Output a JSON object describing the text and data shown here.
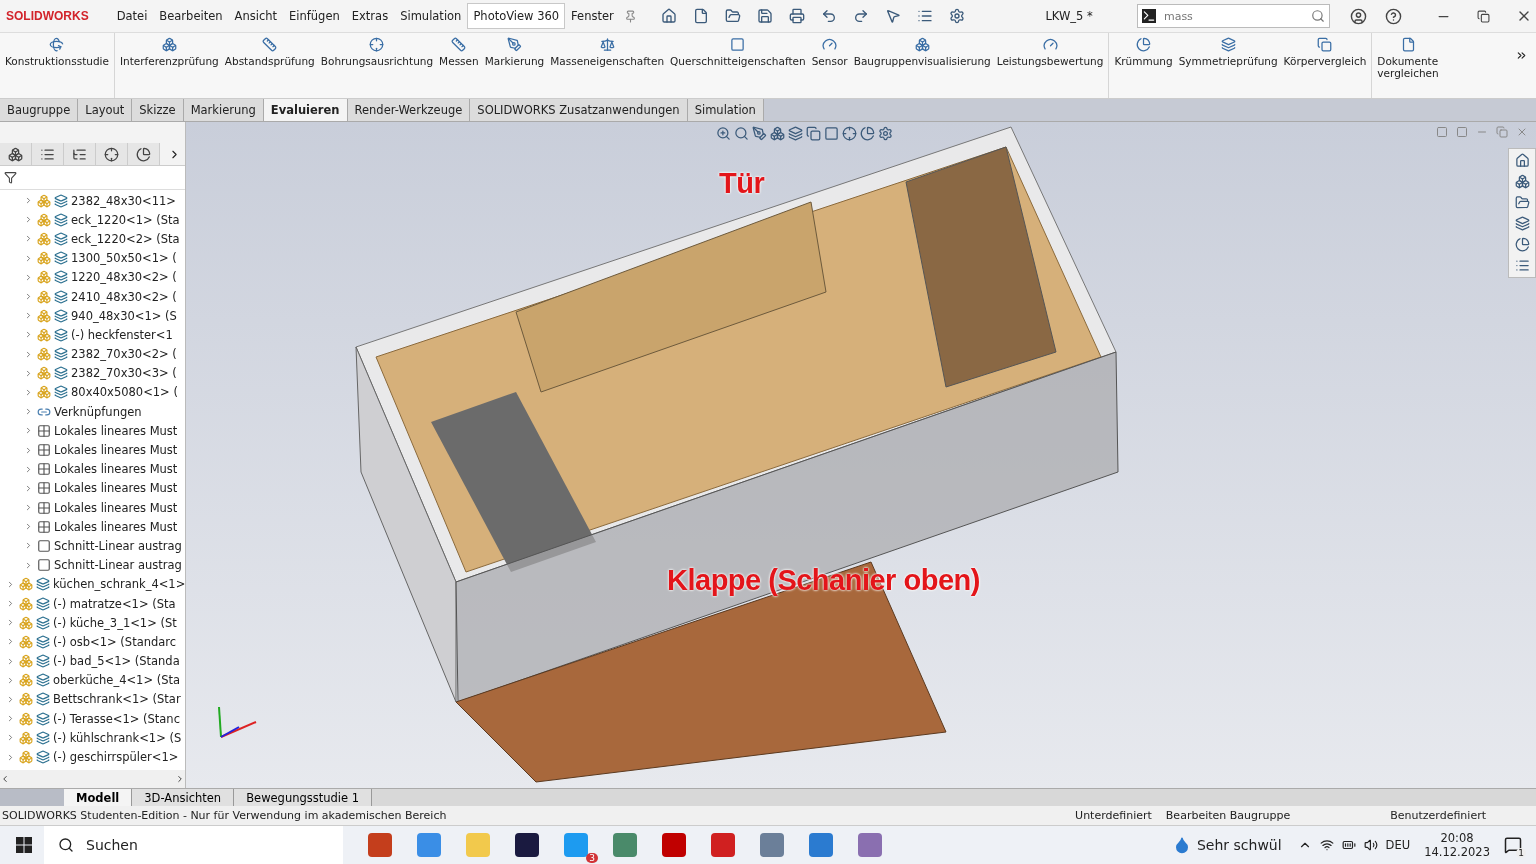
{
  "app": {
    "logo": "SOLIDWORKS",
    "document_title": "LKW_5 *"
  },
  "menu": [
    {
      "label": "Datei",
      "highlighted": false
    },
    {
      "label": "Bearbeiten",
      "highlighted": false
    },
    {
      "label": "Ansicht",
      "highlighted": false
    },
    {
      "label": "Einfügen",
      "highlighted": false
    },
    {
      "label": "Extras",
      "highlighted": false
    },
    {
      "label": "Simulation",
      "highlighted": false
    },
    {
      "label": "PhotoView 360",
      "highlighted": true
    },
    {
      "label": "Fenster",
      "highlighted": false
    }
  ],
  "search": {
    "value": "mass"
  },
  "ribbon": {
    "groups": [
      [
        "Konstruktionsstudie"
      ],
      [
        "Interferenzprüfung",
        "Abstandsprüfung",
        "Bohrungsausrichtung",
        "Messen",
        "Markierung",
        "Masseneigenschaften",
        "Querschnitteigenschaften",
        "Sensor",
        "Baugruppenvisualisierung",
        "Leistungsbewertung"
      ],
      [
        "Krümmung",
        "Symmetrieprüfung",
        "Körpervergleich"
      ],
      [
        "Dokumente vergleichen"
      ]
    ]
  },
  "command_tabs": [
    {
      "label": "Baugruppe",
      "selected": false
    },
    {
      "label": "Layout",
      "selected": false
    },
    {
      "label": "Skizze",
      "selected": false
    },
    {
      "label": "Markierung",
      "selected": false
    },
    {
      "label": "Evaluieren",
      "selected": true
    },
    {
      "label": "Render-Werkzeuge",
      "selected": false
    },
    {
      "label": "SOLIDWORKS Zusatzanwendungen",
      "selected": false
    },
    {
      "label": "Simulation",
      "selected": false
    }
  ],
  "tree": {
    "continued_children": [
      {
        "label": "2382_48x30<11>",
        "kind": "part"
      },
      {
        "label": "eck_1220<1> (Sta",
        "kind": "part"
      },
      {
        "label": "eck_1220<2> (Sta",
        "kind": "part"
      },
      {
        "label": "1300_50x50<1> (",
        "kind": "part"
      },
      {
        "label": "1220_48x30<2> (",
        "kind": "part"
      },
      {
        "label": "2410_48x30<2> (",
        "kind": "part"
      },
      {
        "label": "940_48x30<1> (S",
        "kind": "part"
      },
      {
        "label": "(-) heckfenster<1",
        "kind": "part"
      },
      {
        "label": "2382_70x30<2> (",
        "kind": "part"
      },
      {
        "label": "2382_70x30<3> (",
        "kind": "part"
      },
      {
        "label": "80x40x5080<1> (",
        "kind": "part"
      },
      {
        "label": "Verknüpfungen",
        "kind": "mates"
      },
      {
        "label": "Lokales lineares Must",
        "kind": "pattern"
      },
      {
        "label": "Lokales lineares Must",
        "kind": "pattern"
      },
      {
        "label": "Lokales lineares Must",
        "kind": "pattern"
      },
      {
        "label": "Lokales lineares Must",
        "kind": "pattern"
      },
      {
        "label": "Lokales lineares Must",
        "kind": "pattern"
      },
      {
        "label": "Lokales lineares Must",
        "kind": "pattern"
      },
      {
        "label": "Schnitt-Linear austrag",
        "kind": "cut"
      },
      {
        "label": "Schnitt-Linear austrag",
        "kind": "cut"
      }
    ],
    "items": [
      {
        "label": "küchen_schrank_4<1>",
        "kind": "part"
      },
      {
        "label": "(-) matratze<1> (Sta",
        "kind": "part"
      },
      {
        "label": "(-) küche_3_1<1> (St",
        "kind": "part"
      },
      {
        "label": "(-) osb<1> (Standarc",
        "kind": "part"
      },
      {
        "label": "(-) bad_5<1> (Standa",
        "kind": "part"
      },
      {
        "label": "oberküche_4<1> (Sta",
        "kind": "part"
      },
      {
        "label": "Bettschrank<1> (Star",
        "kind": "part"
      },
      {
        "label": "(-) Terasse<1> (Stanc",
        "kind": "part"
      },
      {
        "label": "(-) kühlschrank<1> (S",
        "kind": "part"
      },
      {
        "label": "(-) geschirrspüler<1>",
        "kind": "part"
      }
    ]
  },
  "viewport": {
    "annotations": [
      "Tür",
      "Klappe (Schanier oben)"
    ]
  },
  "bottom_tabs": [
    {
      "label": "Modell",
      "selected": true
    },
    {
      "label": "3D-Ansichten",
      "selected": false
    },
    {
      "label": "Bewegungsstudie 1",
      "selected": false
    }
  ],
  "status_bar": {
    "message": "SOLIDWORKS Studenten-Edition - Nur für Verwendung im akademischen Bereich",
    "state": "Unterdefiniert",
    "mode": "Bearbeiten Baugruppe",
    "units": "Benutzerdefiniert"
  },
  "taskbar": {
    "search_placeholder": "Suchen",
    "chat_badge": "3",
    "weather": "Sehr schwül",
    "language": "DEU",
    "time": "20:08",
    "date": "14.12.2023",
    "notifications": "1"
  }
}
